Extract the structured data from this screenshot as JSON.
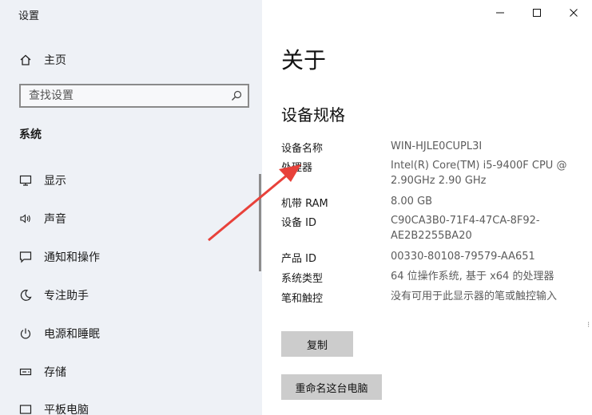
{
  "window": {
    "title": "设置"
  },
  "sidebar": {
    "home_label": "主页",
    "search_placeholder": "查找设置",
    "section_label": "系统",
    "items": [
      {
        "label": "显示",
        "icon": "monitor-icon"
      },
      {
        "label": "声音",
        "icon": "speaker-icon"
      },
      {
        "label": "通知和操作",
        "icon": "notification-icon"
      },
      {
        "label": "专注助手",
        "icon": "moon-icon"
      },
      {
        "label": "电源和睡眠",
        "icon": "power-icon"
      },
      {
        "label": "存储",
        "icon": "storage-icon"
      },
      {
        "label": "平板电脑",
        "icon": "tablet-icon"
      }
    ]
  },
  "main": {
    "title": "关于",
    "specs_heading": "设备规格",
    "specs": [
      {
        "key": "设备名称",
        "value": "WIN-HJLE0CUPL3I"
      },
      {
        "key": "处理器",
        "value": "Intel(R) Core(TM) i5-9400F CPU @ 2.90GHz   2.90 GHz"
      },
      {
        "key": "机带 RAM",
        "value": "8.00 GB"
      },
      {
        "key": "设备 ID",
        "value": "C90CA3B0-71F4-47CA-8F92-AE2B2255BA20"
      },
      {
        "key": "产品 ID",
        "value": "00330-80108-79579-AA651"
      },
      {
        "key": "系统类型",
        "value": "64 位操作系统, 基于 x64 的处理器"
      },
      {
        "key": "笔和触控",
        "value": "没有可用于此显示器的笔或触控输入"
      }
    ],
    "copy_label": "复制",
    "rename_label": "重命名这台电脑"
  },
  "colors": {
    "sidebar_bg": "#eef1f6",
    "arrow": "#e8413a",
    "button_bg": "#cccccc"
  }
}
